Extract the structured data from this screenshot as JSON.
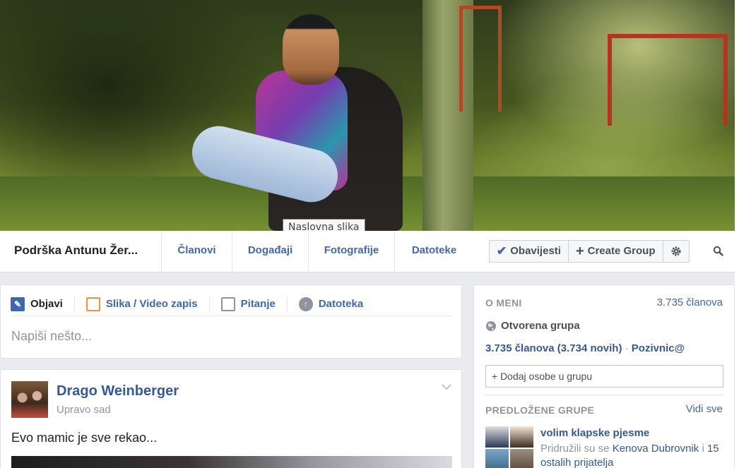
{
  "cover": {
    "tooltip": "Naslovna slika"
  },
  "nav": {
    "group_name": "Podrška Antunu Žer...",
    "tabs": [
      "Članovi",
      "Događaji",
      "Fotografije",
      "Datoteke"
    ],
    "notifications_label": "Obavijesti",
    "create_group_label": "Create Group"
  },
  "composer": {
    "tabs": [
      "Objavi",
      "Slika / Video zapis",
      "Pitanje",
      "Datoteka"
    ],
    "placeholder": "Napiši nešto..."
  },
  "post": {
    "author": "Drago Weinberger",
    "timestamp": "Upravo sad",
    "text": "Evo mamic je sve rekao..."
  },
  "sidebar": {
    "about_title": "O MENI",
    "members_count": "3.735 članova",
    "privacy": "Otvorena grupa",
    "members_detail": "3.735 članova",
    "members_new": "(3.734 novih)",
    "separator": "·",
    "invite_link": "Pozivnic@",
    "add_people": "+ Dodaj osobe u grupu",
    "suggested_title": "PREDLOŽENE GRUPE",
    "see_all": "Vidi sve",
    "suggestion": {
      "name": "volim klapske pjesme",
      "joined_prefix": "Pridružili su se",
      "friend": "Kenova Dubrovnik",
      "joined_mid": "i",
      "others": "15 ostalih prijatelja"
    }
  },
  "colors": {
    "link": "#4267b2",
    "name": "#365899",
    "muted": "#90949c",
    "background": "#e9ebee"
  }
}
